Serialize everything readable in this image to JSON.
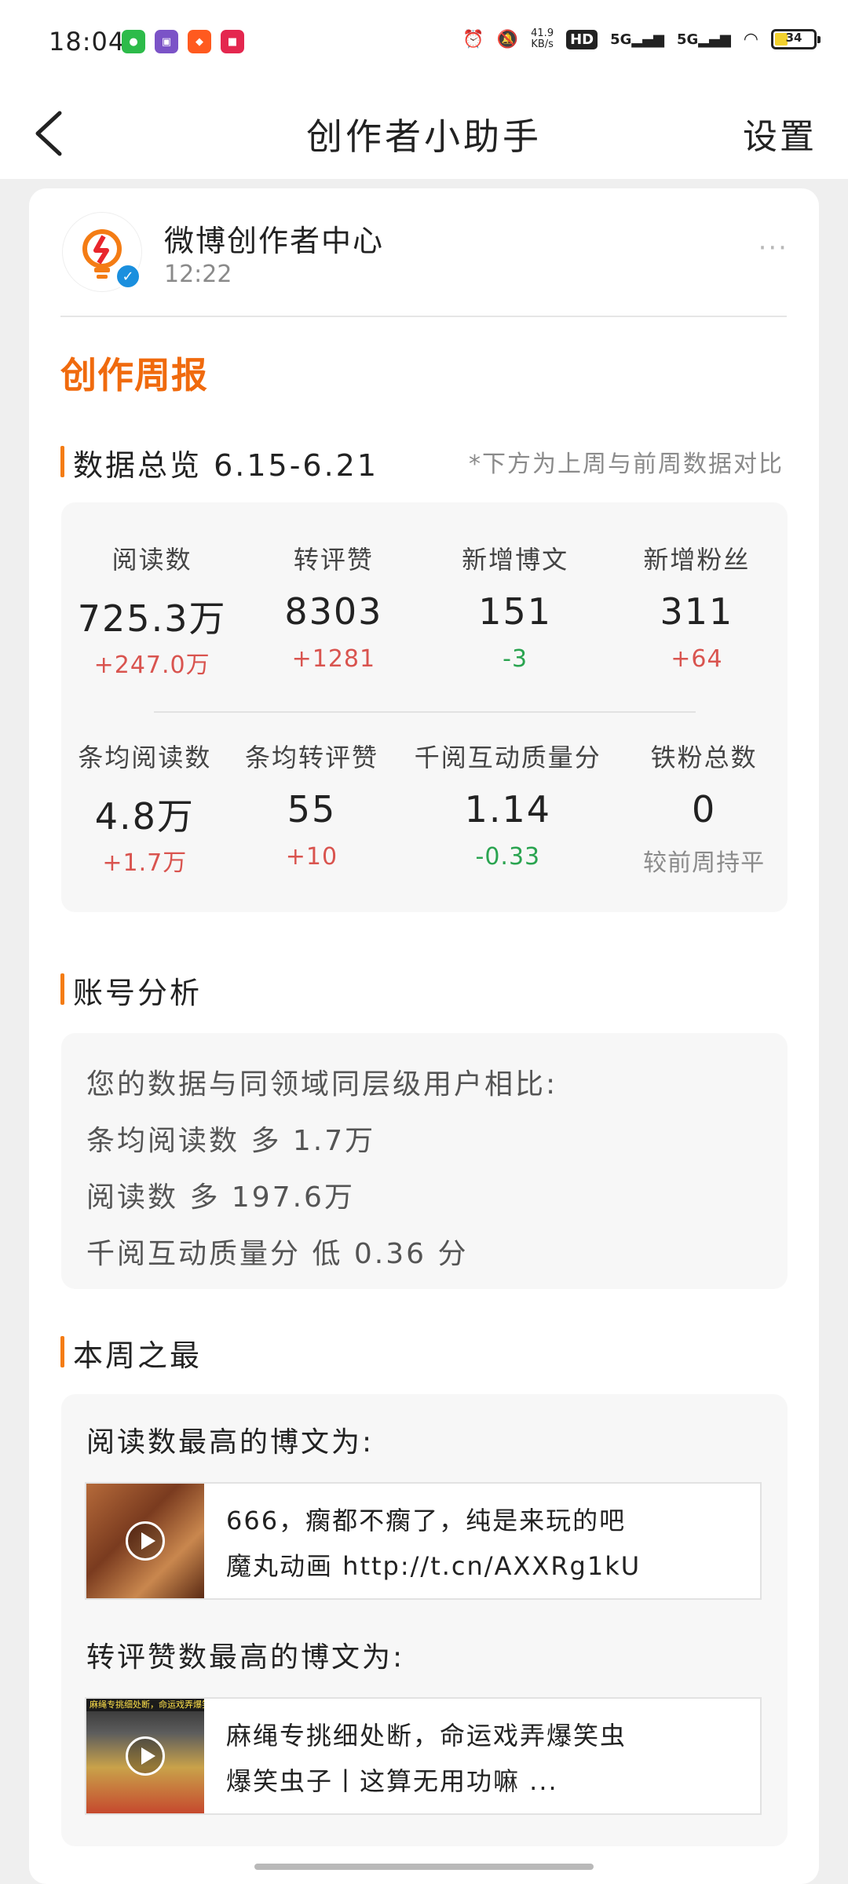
{
  "status_bar": {
    "time": "18:04",
    "apps": [
      "wechat-icon",
      "app-badge-icon",
      "taobao-icon",
      "shop-icon"
    ],
    "net_speed_value": "41.9",
    "net_speed_unit": "KB/s",
    "hd_label": "HD",
    "signal1": "5G",
    "signal2": "5G",
    "battery": "34",
    "battery_level": 0.34
  },
  "nav": {
    "title": "创作者小助手",
    "settings": "设置"
  },
  "header": {
    "account_name": "微博创作者中心",
    "time": "12:22",
    "more": "···"
  },
  "weekly_title": "创作周报",
  "overview": {
    "title": "数据总览 6.15-6.21",
    "note": "*下方为上周与前周数据对比",
    "row1": [
      {
        "label": "阅读数",
        "value": "725.3万",
        "delta": "+247.0万",
        "trend": "up"
      },
      {
        "label": "转评赞",
        "value": "8303",
        "delta": "+1281",
        "trend": "up"
      },
      {
        "label": "新增博文",
        "value": "151",
        "delta": "-3",
        "trend": "down"
      },
      {
        "label": "新增粉丝",
        "value": "311",
        "delta": "+64",
        "trend": "up"
      }
    ],
    "row2": [
      {
        "label": "条均阅读数",
        "value": "4.8万",
        "delta": "+1.7万",
        "trend": "up"
      },
      {
        "label": "条均转评赞",
        "value": "55",
        "delta": "+10",
        "trend": "up"
      },
      {
        "label": "千阅互动质量分",
        "value": "1.14",
        "delta": "-0.33",
        "trend": "down"
      },
      {
        "label": "铁粉总数",
        "value": "0",
        "delta": "较前周持平",
        "trend": "flat"
      }
    ]
  },
  "analysis": {
    "title": "账号分析",
    "lines": [
      "您的数据与同领域同层级用户相比:",
      "条均阅读数 多 1.7万",
      "阅读数 多 197.6万",
      "千阅互动质量分 低 0.36 分"
    ]
  },
  "best": {
    "title": "本周之最",
    "reads_label": "阅读数最高的博文为:",
    "reads_post": {
      "line1": "666，瘸都不瘸了，纯是来玩的吧",
      "line2": "魔丸动画 http://t.cn/AXXRg1kU"
    },
    "interactions_label": "转评赞数最高的博文为:",
    "interactions_post": {
      "thumb_caption": "麻绳专挑细处断，命运戏弄爆笑虫!",
      "line1": "麻绳专挑细处断，命运戏弄爆笑虫",
      "line2": "爆笑虫子丨这算无用功嘛 ..."
    }
  },
  "colors": {
    "accent_orange": "#f06a0d",
    "up_red": "#d9544f",
    "down_green": "#2aa450",
    "verified_blue": "#1a8fde"
  }
}
